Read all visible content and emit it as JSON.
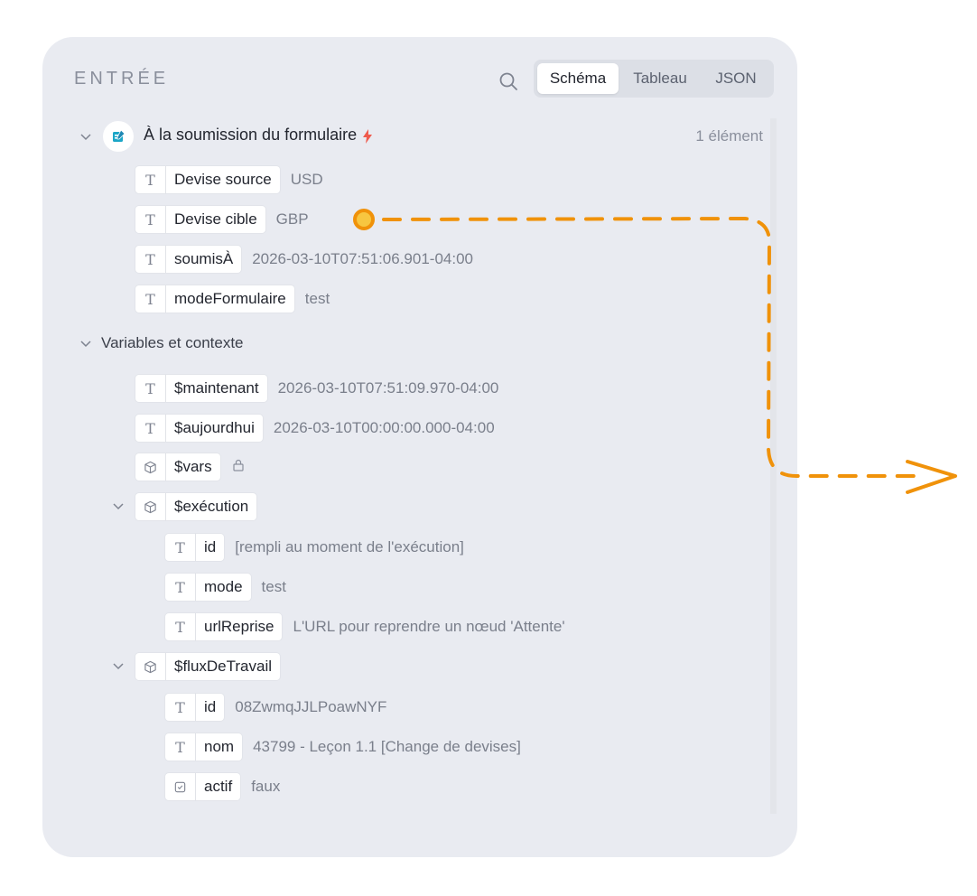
{
  "panel": {
    "heading": "ENTRÉE",
    "tabs": [
      {
        "label": "Schéma",
        "active": true
      },
      {
        "label": "Tableau",
        "active": false
      },
      {
        "label": "JSON",
        "active": false
      }
    ]
  },
  "trigger": {
    "label": "À la soumission du formulaire",
    "count": "1 élément",
    "fields": [
      {
        "type": "T",
        "name": "Devise source",
        "value": "USD"
      },
      {
        "type": "T",
        "name": "Devise cible",
        "value": "GBP"
      },
      {
        "type": "T",
        "name": "soumisÀ",
        "value": "2026-03-10T07:51:06.901-04:00"
      },
      {
        "type": "T",
        "name": "modeFormulaire",
        "value": "test"
      }
    ]
  },
  "variables": {
    "label": "Variables et contexte",
    "fields": [
      {
        "type": "T",
        "name": "$maintenant",
        "value": "2026-03-10T07:51:09.970-04:00"
      },
      {
        "type": "T",
        "name": "$aujourdhui",
        "value": "2026-03-10T00:00:00.000-04:00"
      },
      {
        "type": "object",
        "name": "$vars",
        "value": ""
      }
    ],
    "execution": {
      "name": "$exécution",
      "fields": [
        {
          "type": "T",
          "name": "id",
          "value": "[rempli au moment de l'exécution]"
        },
        {
          "type": "T",
          "name": "mode",
          "value": "test"
        },
        {
          "type": "T",
          "name": "urlReprise",
          "value": "L'URL pour reprendre un nœud 'Attente'"
        }
      ]
    },
    "workflow": {
      "name": "$fluxDeTravail",
      "fields": [
        {
          "type": "T",
          "name": "id",
          "value": "08ZwmqJJLPoawNYF"
        },
        {
          "type": "T",
          "name": "nom",
          "value": "43799 - Leçon 1.1 [Change de devises]"
        },
        {
          "type": "bool",
          "name": "actif",
          "value": "faux"
        }
      ]
    }
  },
  "colors": {
    "panel_bg": "#e9ebf1",
    "accent_orange": "#f0920a",
    "bolt": "#ef5b4d",
    "trigger_icon": "#1ba6c7"
  },
  "icons": [
    "search-icon",
    "chevron-down-icon",
    "text-type-icon",
    "object-cube-icon",
    "lock-icon",
    "checkbox-icon",
    "lightning-icon",
    "form-icon",
    "arrow-right-icon"
  ]
}
